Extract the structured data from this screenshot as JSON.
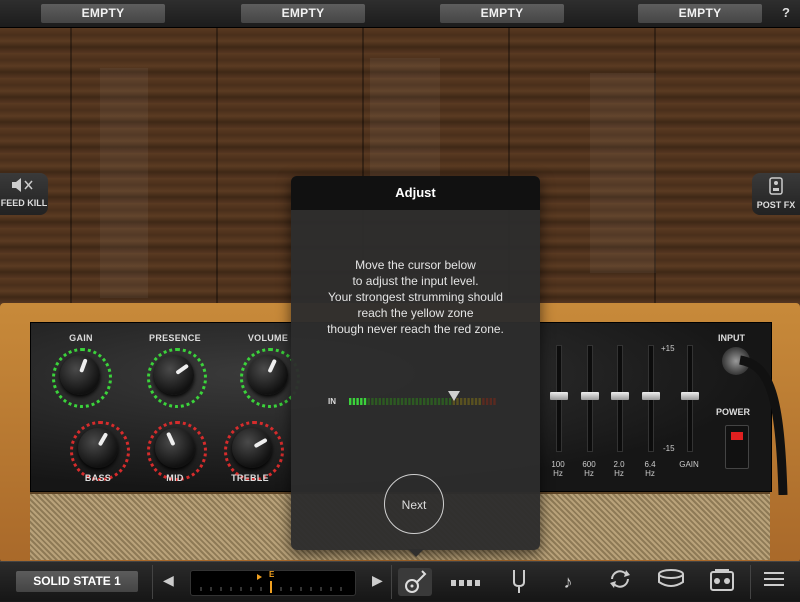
{
  "top_slots": [
    "EMPTY",
    "EMPTY",
    "EMPTY",
    "EMPTY"
  ],
  "help_label": "?",
  "side_buttons": {
    "feed_kill": "FEED KILL",
    "post_fx": "POST FX"
  },
  "amp": {
    "knob_labels_top": [
      "GAIN",
      "PRESENCE",
      "VOLUME"
    ],
    "knob_labels_bottom": [
      "BASS",
      "MID",
      "TREBLE"
    ],
    "eq_bands": [
      "100\nHz",
      "600\nHz",
      "2.0\nHz",
      "6.4\nHz",
      "GAIN"
    ],
    "eq_scale_top": "+15",
    "eq_scale_bottom": "-15",
    "input_label": "INPUT",
    "power_label": "POWER"
  },
  "dialog": {
    "title": "Adjust",
    "message": "Move the cursor below\nto adjust the input level.\nYour strongest strumming should\nreach the yellow zone\nthough never reach the red zone.",
    "meter_label": "IN",
    "input_level": 0.67,
    "next_label": "Next"
  },
  "bottom": {
    "preset_name": "SOLID STATE 1",
    "tuner_note": "E",
    "icons": [
      "guitar-icon",
      "grid-icon",
      "tuning-fork-icon",
      "note-icon",
      "loop-icon",
      "drum-icon",
      "amp-icon",
      "menu-icon"
    ]
  },
  "colors": {
    "meter_green": "#3bd33b",
    "power_red": "#e02020",
    "wood": "#5a3a22",
    "amp_trim": "#c88a3a"
  }
}
